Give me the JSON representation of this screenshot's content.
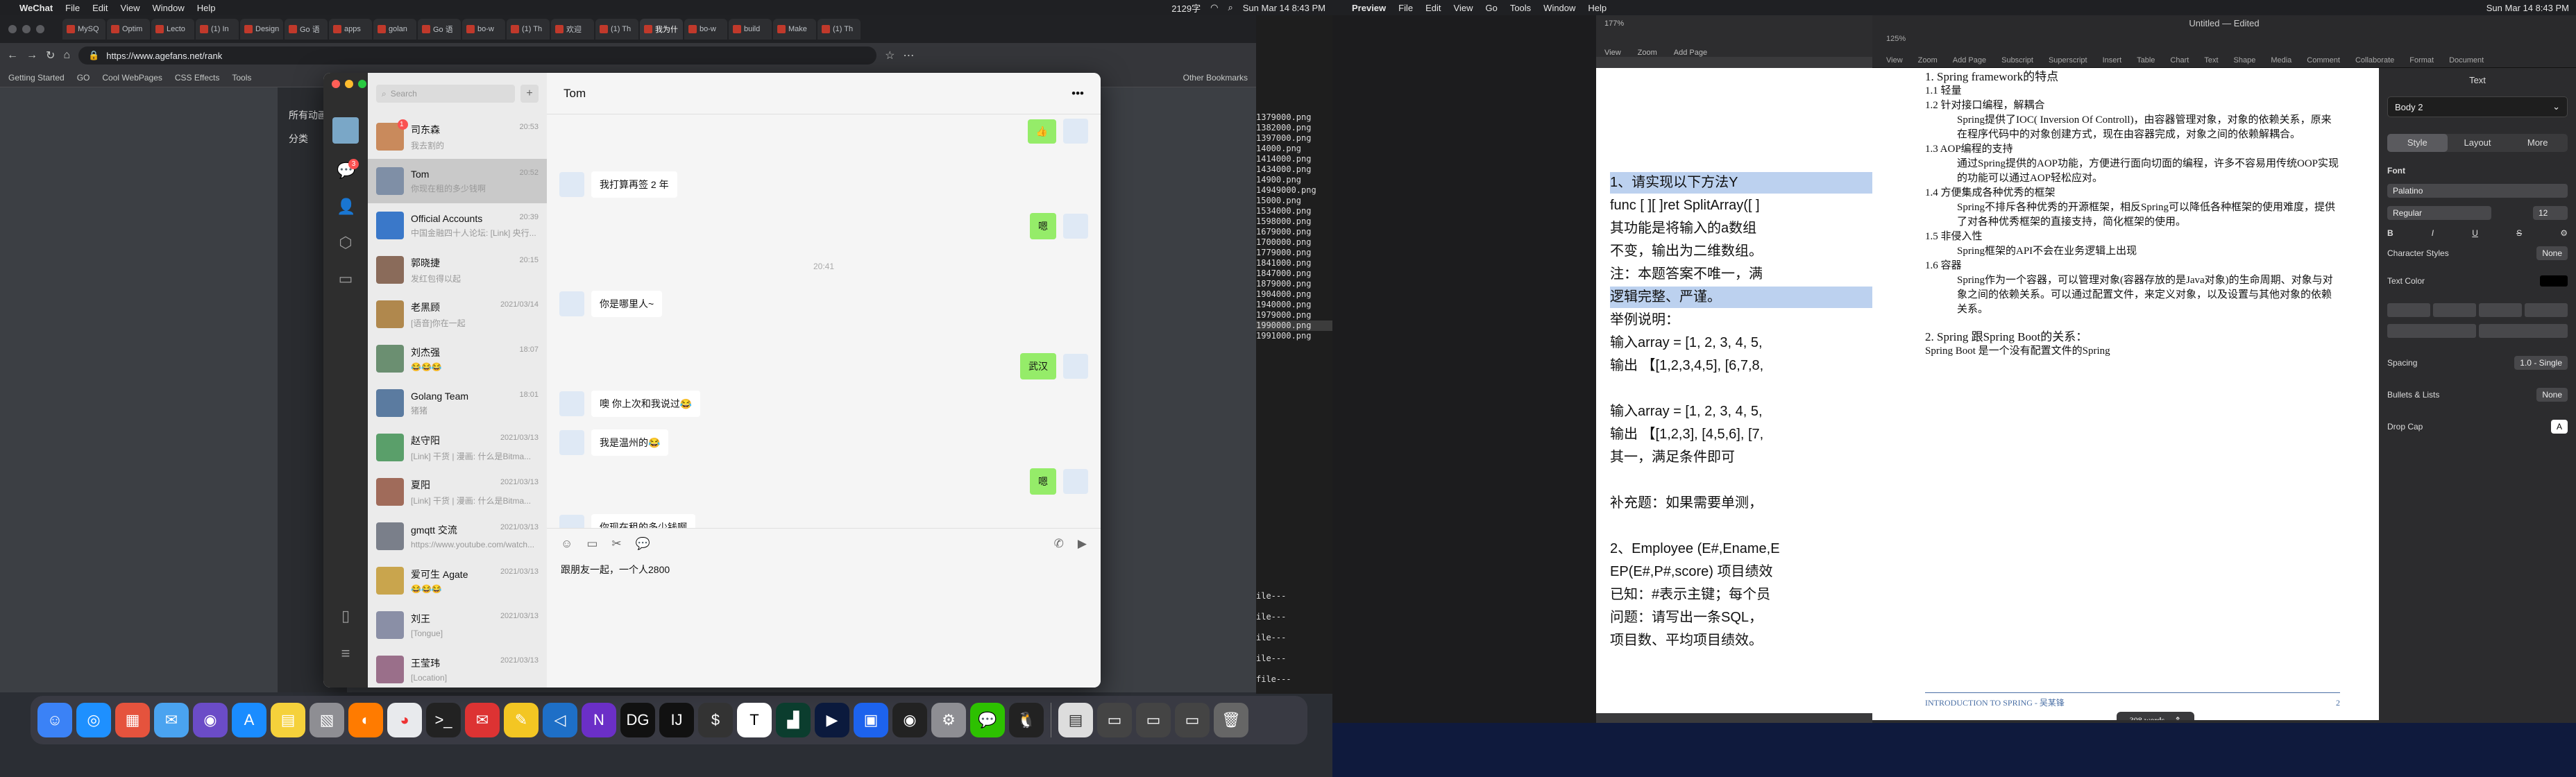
{
  "left_menubar": {
    "app": "WeChat",
    "items": [
      "File",
      "Edit",
      "View",
      "Window",
      "Help"
    ],
    "status": "2129字",
    "datetime": "Sun Mar 14  8:43 PM"
  },
  "browser": {
    "tabs": [
      "MySQ",
      "Optim",
      "Lecto",
      "(1) In",
      "Design",
      "Go 语",
      "apps",
      "golan",
      "Go 语",
      "bo-w",
      "(1) Th",
      "欢迎",
      "(1) Th",
      "我为什",
      "bo-w",
      "build",
      "Make",
      "(1) Th"
    ],
    "url": "https://www.agefans.net/rank",
    "bookmarks": [
      "Getting Started",
      "GO",
      "Cool WebPages",
      "CSS Effects",
      "Tools",
      "Other Bookmarks"
    ],
    "page_heading": "所有动画",
    "page_tab": "分类"
  },
  "terminal_lines": [
    "1379000.png",
    "1382000.png",
    "1397000.png",
    "14000.png",
    "1414000.png",
    "1434000.png",
    "14900.png",
    "14949000.png",
    "15000.png",
    "1534000.png",
    "1598000.png",
    "1679000.png",
    "1700000.png",
    "1779000.png",
    "1841000.png",
    "1847000.png",
    "1879000.png",
    "1904000.png",
    "1940000.png",
    "1979000.png",
    "1990000.png",
    "1991000.png"
  ],
  "terminal_tail": [
    "ile---",
    "ile---",
    "ile---",
    "ile---",
    "file---",
    "file---"
  ],
  "wechat": {
    "search_placeholder": "Search",
    "badge_chats": "3",
    "conversations": [
      {
        "name": "司东森",
        "time": "20:53",
        "preview": "我去割的",
        "badge": "1"
      },
      {
        "name": "Tom",
        "time": "20:52",
        "preview": "你现在租的多少钱啊",
        "badge": ""
      },
      {
        "name": "Official Accounts",
        "time": "20:39",
        "preview": "中国金融四十人论坛: [Link] 央行...",
        "badge": ""
      },
      {
        "name": "郭晓捷",
        "time": "20:15",
        "preview": "发红包得以起",
        "badge": ""
      },
      {
        "name": "老黑顾",
        "time": "2021/03/14",
        "preview": "[语音]你在一起",
        "badge": ""
      },
      {
        "name": "刘杰强",
        "time": "18:07",
        "preview": "😂😂😂",
        "badge": ""
      },
      {
        "name": "Golang Team",
        "time": "18:01",
        "preview": "猪猪",
        "badge": ""
      },
      {
        "name": "赵守阳",
        "time": "2021/03/13",
        "preview": "[Link] 干货 | 漫画: 什么是Bitma...",
        "badge": ""
      },
      {
        "name": "夏阳",
        "time": "2021/03/13",
        "preview": "[Link] 干货 | 漫画: 什么是Bitma...",
        "badge": ""
      },
      {
        "name": "gmqtt 交流",
        "time": "2021/03/13",
        "preview": "https://www.youtube.com/watch...",
        "badge": ""
      },
      {
        "name": "爱可生 Agate",
        "time": "2021/03/13",
        "preview": "😂😂😂",
        "badge": ""
      },
      {
        "name": "刘王",
        "time": "2021/03/13",
        "preview": "[Tongue]",
        "badge": ""
      },
      {
        "name": "王莹玮",
        "time": "2021/03/13",
        "preview": "[Location]",
        "badge": ""
      }
    ],
    "chat_title": "Tom",
    "messages": [
      {
        "from": "me",
        "text": "👍"
      },
      {
        "from": "them",
        "text": "我打算再签 2 年"
      },
      {
        "from": "me",
        "text": "嗯"
      },
      {
        "timestamp": "20:41"
      },
      {
        "from": "them",
        "text": "你是哪里人~"
      },
      {
        "from": "me",
        "text": "武汉"
      },
      {
        "from": "them",
        "text": "噢 你上次和我说过😂"
      },
      {
        "from": "them",
        "text": "我是温州的😂"
      },
      {
        "from": "me",
        "text": "嗯"
      },
      {
        "from": "them",
        "text": "你现在租的多少钱啊"
      }
    ],
    "draft": "跟朋友一起，一个人2800"
  },
  "right_menubar": {
    "app": "Preview",
    "items": [
      "File",
      "Edit",
      "View",
      "Go",
      "Tools",
      "Window",
      "Help"
    ],
    "datetime": "Sun Mar 14  8:43 PM"
  },
  "preview": {
    "zoom": "177%",
    "tools": [
      "View",
      "Zoom",
      "Add Page"
    ],
    "lines": [
      "1、请实现以下方法Y",
      "func [ ][ ]ret SplitArray([ ]",
      "其功能是将输入的a数组",
      "不变，输出为二维数组。",
      "注：本题答案不唯一，满",
      "逻辑完整、严谨。",
      "举例说明：",
      "输入array = [1, 2, 3, 4, 5,",
      "输出 【[1,2,3,4,5], [6,7,8,",
      "",
      "输入array = [1, 2, 3, 4, 5,",
      "输出 【[1,2,3], [4,5,6], [7,",
      "其一，满足条件即可",
      "",
      "补充题：如果需要单测，",
      "",
      "2、Employee (E#,Ename,E",
      "EP(E#,P#,score) 项目绩效",
      "已知：#表示主键；每个员",
      "问题：请写出一条SQL，",
      "项目数、平均项目绩效。"
    ]
  },
  "pages": {
    "title": "Untitled — Edited",
    "zoom": "125%",
    "toolbar": [
      "View",
      "Zoom",
      "Add Page",
      "Subscript",
      "Superscript",
      "Insert",
      "Table",
      "Chart",
      "Text",
      "Shape",
      "Media",
      "Comment",
      "Collaborate",
      "Format",
      "Document"
    ],
    "content": [
      {
        "type": "h",
        "text": "1.  Spring framework的特点"
      },
      {
        "type": "p",
        "text": "1.1  轻量"
      },
      {
        "type": "p",
        "text": "1.2  针对接口编程，解耦合"
      },
      {
        "type": "i",
        "text": "Spring提供了IOC( Inversion Of Controll)，由容器管理对象，对象的依赖关系，原来在程序代码中的对象创建方式，现在由容器完成，对象之间的依赖解耦合。"
      },
      {
        "type": "p",
        "text": "1.3  AOP编程的支持"
      },
      {
        "type": "i",
        "text": "通过Spring提供的AOP功能，方便进行面向切面的编程，许多不容易用传统OOP实现的功能可以通过AOP轻松应对。"
      },
      {
        "type": "p",
        "text": "1.4  方便集成各种优秀的框架"
      },
      {
        "type": "i",
        "text": "Spring不排斥各种优秀的开源框架，相反Spring可以降低各种框架的使用难度，提供了对各种优秀框架的直接支持，简化框架的使用。"
      },
      {
        "type": "p",
        "text": "1.5  非侵入性"
      },
      {
        "type": "i",
        "text": "Spring框架的API不会在业务逻辑上出现"
      },
      {
        "type": "p",
        "text": "1.6  容器"
      },
      {
        "type": "i",
        "text": "Spring作为一个容器，可以管理对象(容器存放的是Java对象)的生命周期、对象与对象之间的依赖关系。可以通过配置文件，来定义对象，以及设置与其他对象的依赖关系。"
      },
      {
        "type": "h",
        "text": "2.  Spring 跟Spring Boot的关系："
      },
      {
        "type": "p",
        "text": "Spring Boot 是一个没有配置文件的Spring"
      }
    ],
    "footer_left": "INTRODUCTION TO SPRING - 吴某锋",
    "footer_right": "2",
    "word_count": "308 words",
    "inspector": {
      "header": "Text",
      "style": "Body 2",
      "tabs": [
        "Style",
        "Layout",
        "More"
      ],
      "font_label": "Font",
      "font": "Palatino",
      "typeface": "Regular",
      "size": "12",
      "char_styles_label": "Character Styles",
      "char_styles": "None",
      "text_color_label": "Text Color",
      "spacing_label": "Spacing",
      "spacing": "1.0 - Single",
      "bullets_label": "Bullets & Lists",
      "bullets": "None",
      "dropcap_label": "Drop Cap"
    }
  }
}
